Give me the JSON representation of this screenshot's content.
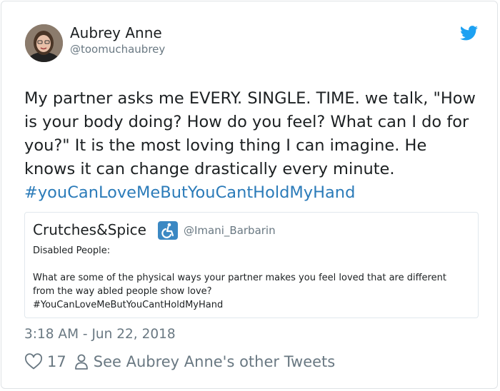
{
  "author": {
    "name": "Aubrey Anne",
    "handle": "@toomuchaubrey"
  },
  "tweet": {
    "text": "My partner asks me EVERY. SINGLE. TIME. we talk, \"How is your body doing? How do you feel? What can I do for you?\" It is the most loving thing I can imagine. He knows it can change drastically every minute. ",
    "hashtag": "#youCanLoveMeButYouCantHoldMyHand"
  },
  "quoted_tweet": {
    "name": "Crutches&Spice",
    "handle": "@Imani_Barbarin",
    "line1": "Disabled People:",
    "line2": "What are some of the physical ways your partner makes you feel loved that are different from the way abled people show love?",
    "hashtag": "#YouCanLoveMeButYouCantHoldMyHand"
  },
  "timestamp": "3:18 AM - Jun 22, 2018",
  "actions": {
    "like_count": "17",
    "other_tweets_label": "See Aubrey Anne's other Tweets"
  },
  "colors": {
    "link": "#2b7bb9",
    "twitter_blue": "#1da1f2",
    "secondary_text": "#697882",
    "wheelchair_badge": "#3b88c3"
  },
  "icons": [
    "twitter-bird-icon",
    "wheelchair-icon",
    "heart-icon",
    "person-icon"
  ]
}
